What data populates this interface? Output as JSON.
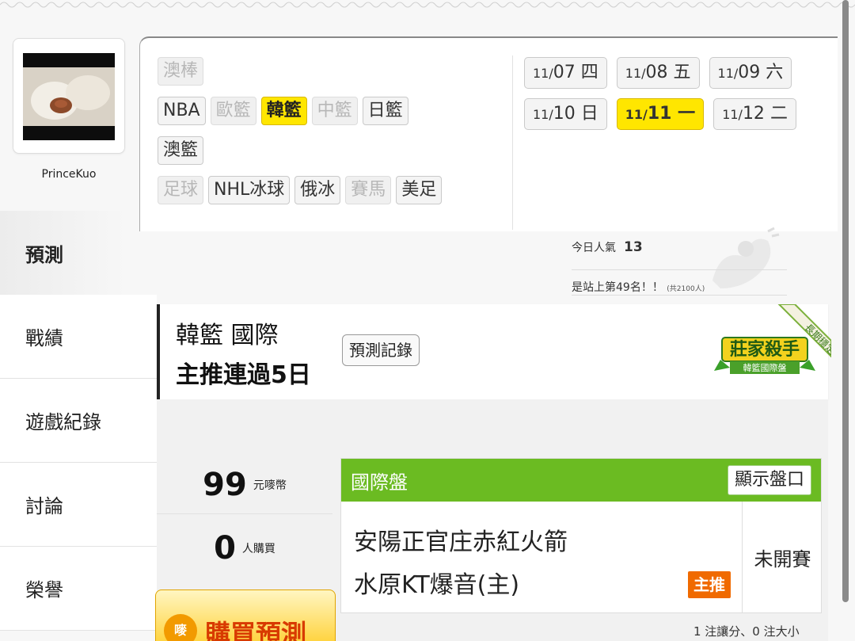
{
  "user": {
    "name": "PrinceKuo"
  },
  "nav": [
    {
      "label": "預測",
      "active": true
    },
    {
      "label": "戰績"
    },
    {
      "label": "遊戲紀錄"
    },
    {
      "label": "討論"
    },
    {
      "label": "榮譽"
    }
  ],
  "leagues": {
    "row1": [
      "澳棒"
    ],
    "row2": [
      "NBA",
      "歐籃",
      "韓籃",
      "中籃",
      "日籃"
    ],
    "row3": [
      "澳籃"
    ],
    "row4": [
      "足球",
      "NHL冰球",
      "俄冰",
      "賽馬",
      "美足"
    ]
  },
  "dates": [
    {
      "md": "11/",
      "d": "07",
      "w": "四"
    },
    {
      "md": "11/",
      "d": "08",
      "w": "五"
    },
    {
      "md": "11/",
      "d": "09",
      "w": "六"
    },
    {
      "md": "11/",
      "d": "10",
      "w": "日"
    },
    {
      "md": "11/",
      "d": "11",
      "w": "一"
    },
    {
      "md": "11/",
      "d": "12",
      "w": "二"
    }
  ],
  "popularity": {
    "label": "今日人氣",
    "value": "13",
    "rank_text": "是站上第49名！！",
    "total_text": "(共2100人)"
  },
  "prediction": {
    "title_line1": "韓籃 國際",
    "title_line2": "主推連過5日",
    "record_button": "預測記錄",
    "badge_main": "莊家殺手",
    "badge_sub": "韓籃國際盤",
    "badge_ribbon": "長期穩定"
  },
  "stats": {
    "price_value": "99",
    "price_unit": "元嘜幣",
    "buyers_value": "0",
    "buyers_unit": "人購買"
  },
  "buy": {
    "icon_text": "嘜",
    "label": "購買預測"
  },
  "odds": {
    "title": "國際盤",
    "show_button": "顯示盤口",
    "team_away": "安陽正官庄赤紅火箭",
    "team_home": "水原KT爆音(主)",
    "main_badge": "主推",
    "status": "未開賽",
    "summary": "1 注讓分、0 注大小"
  },
  "colors": {
    "active_yellow": "#ffe600",
    "odds_green": "#6bbb22",
    "main_orange": "#f06a00"
  }
}
